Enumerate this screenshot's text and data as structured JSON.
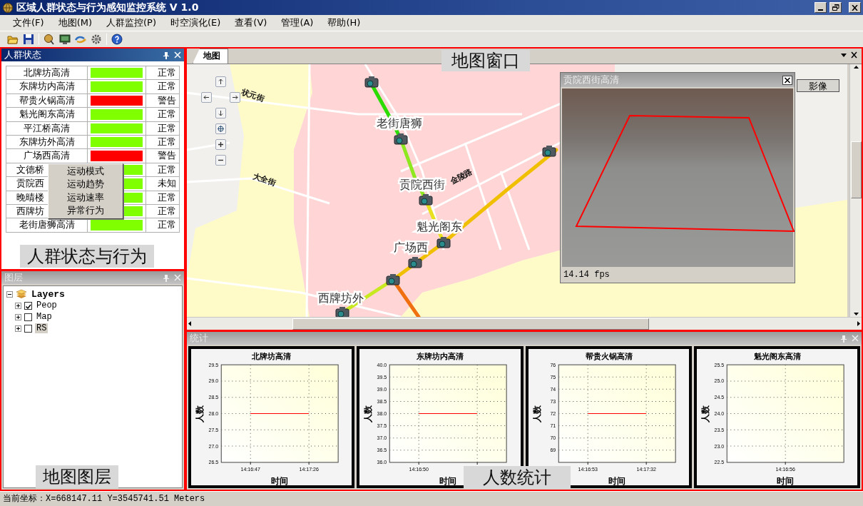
{
  "window": {
    "title": "区域人群状态与行为感知监控系统 V 1.0"
  },
  "menu": [
    "文件(F)",
    "地图(M)",
    "人群监控(P)",
    "时空演化(E)",
    "查看(V)",
    "管理(A)",
    "帮助(H)"
  ],
  "crowd_panel": {
    "title": "人群状态",
    "active": true,
    "rows": [
      {
        "name": "北牌坊高清",
        "color": "#80ff00",
        "status": "正常"
      },
      {
        "name": "东牌坊内高清",
        "color": "#80ff00",
        "status": "正常"
      },
      {
        "name": "帮贵火锅高清",
        "color": "#ff0000",
        "status": "警告"
      },
      {
        "name": "魁光阁东高清",
        "color": "#80ff00",
        "status": "正常"
      },
      {
        "name": "平江桥高清",
        "color": "#80ff00",
        "status": "正常"
      },
      {
        "name": "东牌坊外高清",
        "color": "#80ff00",
        "status": "正常"
      },
      {
        "name": "广场西高清",
        "color": "#ff0000",
        "status": "警告"
      },
      {
        "name": "文德桥",
        "color": "#80ff00",
        "status": "正常"
      },
      {
        "name": "贡院西",
        "color": "#80ff00",
        "status": "未知"
      },
      {
        "name": "晚晴楼",
        "color": "#80ff00",
        "status": "正常"
      },
      {
        "name": "西牌坊",
        "color": "#80ff00",
        "status": "正常"
      },
      {
        "name": "老街唐狮高清",
        "color": "#80ff00",
        "status": "正常"
      }
    ],
    "context_menu": [
      "运动模式",
      "运动趋势",
      "运动速率",
      "异常行为"
    ],
    "annotation": "人群状态与行为"
  },
  "layers_panel": {
    "title": "图层",
    "active": false,
    "tree": {
      "label": "Layers",
      "expanded": true,
      "children": [
        {
          "label": "Peop",
          "checked": true,
          "expanded": false,
          "selected": false
        },
        {
          "label": "Map",
          "checked": false,
          "expanded": false,
          "selected": false
        },
        {
          "label": "RS",
          "checked": false,
          "expanded": false,
          "selected": true
        }
      ]
    },
    "annotation": "地图图层"
  },
  "map_panel": {
    "tabs": [
      {
        "label": "地图",
        "selected": true
      }
    ],
    "annotation": "地图窗口",
    "street_labels": [
      "状元街",
      "大全街",
      "金陵路"
    ],
    "camera_labels": [
      "老街唐狮",
      "贡院西街",
      "魁光阁东",
      "广场西",
      "西牌坊外"
    ],
    "video": {
      "title": "贡院西街高清",
      "fps": "14.14 fps"
    },
    "image_button": "影像"
  },
  "stats_panel": {
    "title": "统计",
    "active": false,
    "annotation": "人数统计",
    "charts": [
      {
        "chart_data": {
          "type": "line",
          "title": "北牌坊高清",
          "xlabel": "时间",
          "ylabel": "人数",
          "grid": true,
          "categories": [
            "14:16:47",
            "14:17:26"
          ],
          "values": [
            28,
            28
          ],
          "ylim": [
            26.5,
            29.5
          ],
          "yticks": [
            26.5,
            {
              "value": 27,
              "label": "27.0"
            },
            27.5,
            {
              "value": 28,
              "label": "28.0"
            },
            28.5,
            {
              "value": 29,
              "label": "29.0"
            },
            29.5
          ]
        }
      },
      {
        "chart_data": {
          "type": "line",
          "title": "东牌坊内高清",
          "xlabel": "时间",
          "ylabel": "人数",
          "grid": true,
          "categories": [
            "14:16:50",
            null
          ],
          "values": [
            38,
            38
          ],
          "ylim": [
            36,
            40
          ],
          "yticks": [
            {
              "value": 36,
              "label": "36.0"
            },
            36.5,
            {
              "value": 37,
              "label": "37.0"
            },
            37.5,
            {
              "value": 38,
              "label": "38.0"
            },
            38.5,
            {
              "value": 39,
              "label": "39.0"
            },
            39.5,
            {
              "value": 40,
              "label": "40.0"
            }
          ]
        }
      },
      {
        "chart_data": {
          "type": "line",
          "title": "帮贵火锅高清",
          "xlabel": "时间",
          "ylabel": "人数",
          "grid": true,
          "categories": [
            "14:16:53",
            "14:17:32"
          ],
          "values": [
            72,
            72
          ],
          "ylim": [
            68,
            76
          ],
          "yticks": [
            69,
            70,
            71,
            72,
            73,
            74,
            75,
            76
          ]
        }
      },
      {
        "chart_data": {
          "type": "line",
          "title": "魁光阁东高清",
          "xlabel": "时间",
          "ylabel": "人数",
          "grid": true,
          "categories": [
            "14:16:56"
          ],
          "values": [
            null
          ],
          "ylim": [
            22.5,
            25.5
          ],
          "yticks": [
            22.5,
            {
              "value": 23,
              "label": "23.0"
            },
            23.5,
            {
              "value": 24,
              "label": "24.0"
            },
            24.5,
            {
              "value": 25,
              "label": "25.0"
            },
            25.5
          ]
        }
      }
    ]
  },
  "status_bar": "当前坐标：X=668147.11 Y=3545741.51 Meters"
}
